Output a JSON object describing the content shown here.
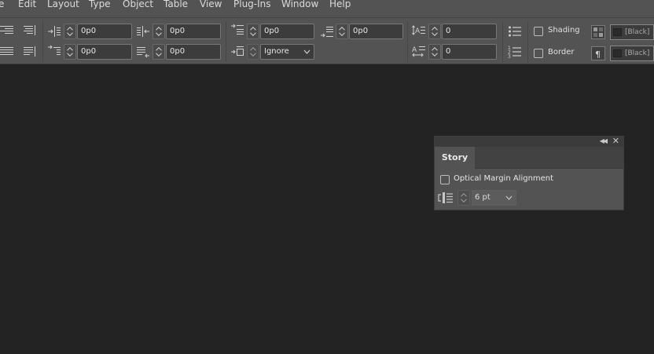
{
  "menu": [
    "e",
    "Edit",
    "Layout",
    "Type",
    "Object",
    "Table",
    "View",
    "Plug-Ins",
    "Window",
    "Help"
  ],
  "control_panel": {
    "left_indent": "0p0",
    "right_indent": "0p0",
    "first_line_indent": "0p0",
    "last_line_indent": "0p0",
    "space_before": "0p0",
    "space_after": "0p0",
    "align_to_grid": "Ignore",
    "drop_cap_lines": "0",
    "drop_cap_chars": "0",
    "shading_label": "Shading",
    "border_label": "Border",
    "shading_color": "[Black]",
    "border_color": "[Black]"
  },
  "story_panel": {
    "tab_label": "Story",
    "optical_margin_label": "Optical Margin Alignment",
    "optical_margin_checked": false,
    "size_value": "6 pt"
  },
  "colors": {
    "app_background": "#232323",
    "panel_background": "#535353",
    "field_background": "#3c3c3c"
  }
}
